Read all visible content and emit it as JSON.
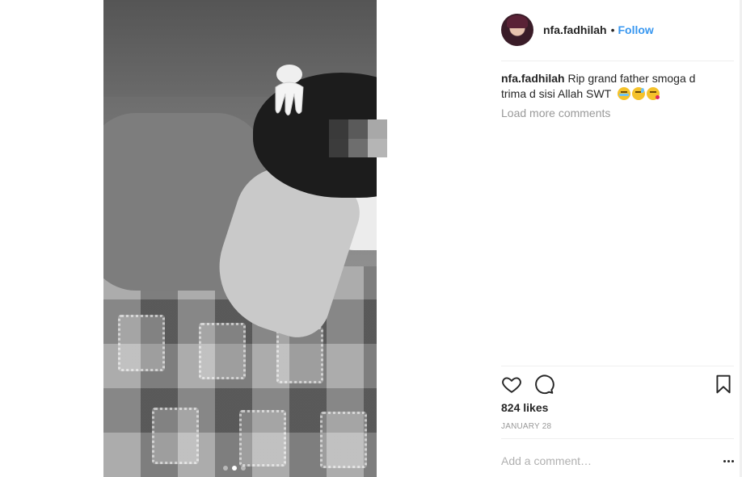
{
  "post": {
    "username": "nfa.fadhilah",
    "bullet": "•",
    "follow_label": "Follow",
    "caption_user": "nfa.fadhilah",
    "caption_text": "Rip grand father smoga d trima d sisi Allah SWT",
    "caption_emojis": [
      "crying-face-emoji",
      "sweat-face-emoji",
      "kiss-face-emoji"
    ],
    "load_more_label": "Load more comments",
    "likes": "824 likes",
    "date": "JANUARY 28",
    "comment_placeholder": "Add a comment…"
  },
  "media": {
    "carousel_dots": 3,
    "active_dot": 1,
    "style": "black-and-white photo"
  },
  "icons": {
    "like": "heart-icon",
    "comment": "comment-bubble-icon",
    "save": "bookmark-icon",
    "options": "more-options-icon"
  },
  "colors": {
    "follow_blue": "#3897f0",
    "text": "#262626",
    "muted": "#999999",
    "divider": "#efefef"
  }
}
